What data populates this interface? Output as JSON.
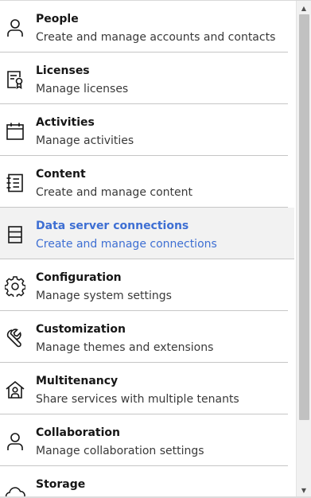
{
  "menu": {
    "items": [
      {
        "title": "People",
        "desc": "Create and manage accounts and contacts",
        "icon": "person-icon"
      },
      {
        "title": "Licenses",
        "desc": "Manage licenses",
        "icon": "license-icon"
      },
      {
        "title": "Activities",
        "desc": "Manage activities",
        "icon": "calendar-icon"
      },
      {
        "title": "Content",
        "desc": "Create and manage content",
        "icon": "notebook-icon"
      },
      {
        "title": "Data server connections",
        "desc": "Create and manage connections",
        "icon": "data-server-icon",
        "selected": true
      },
      {
        "title": "Configuration",
        "desc": "Manage system settings",
        "icon": "gear-icon"
      },
      {
        "title": "Customization",
        "desc": "Manage themes and extensions",
        "icon": "wrench-icon"
      },
      {
        "title": "Multitenancy",
        "desc": "Share services with multiple tenants",
        "icon": "home-person-icon"
      },
      {
        "title": "Collaboration",
        "desc": "Manage collaboration settings",
        "icon": "person-icon"
      },
      {
        "title": "Storage",
        "desc": "",
        "icon": "cloud-icon"
      }
    ],
    "selected_color": "#3e6fd3"
  },
  "scrollbar": {
    "up_arrow": "▲",
    "down_arrow": "▼",
    "position_fraction": 0.0
  }
}
